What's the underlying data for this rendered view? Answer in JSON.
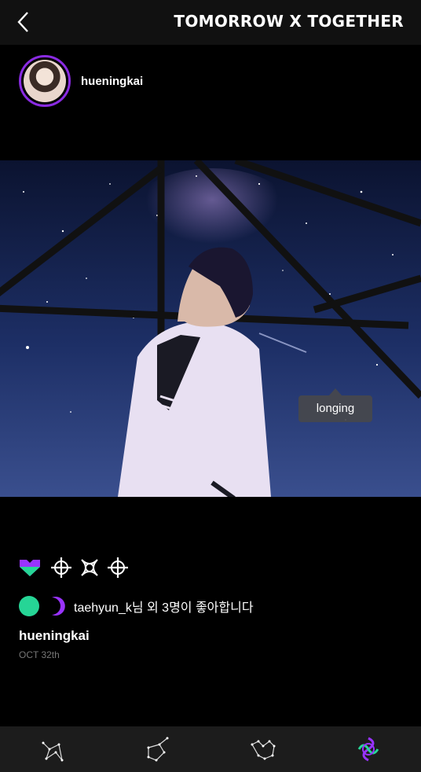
{
  "header": {
    "brand": "TOMORROW X TOGETHER",
    "back_icon": "chevron-left-icon"
  },
  "post": {
    "author": "hueningkai",
    "avatar_ring_color": "#8a2be2",
    "photo_tag": "longing",
    "actions": [
      {
        "name": "like",
        "icon": "heart-icon"
      },
      {
        "name": "reaction-1",
        "icon": "spark-star-icon"
      },
      {
        "name": "reaction-2",
        "icon": "knot-icon"
      },
      {
        "name": "reaction-3",
        "icon": "spark-star-icon"
      }
    ],
    "likes": {
      "avatars": [
        {
          "color": "#26d596"
        },
        {
          "color": "#9933ff"
        }
      ],
      "text": "taehyun_k님 외 3명이 좋아합니다"
    },
    "caption_user": "hueningkai",
    "date": "OCT 32th"
  },
  "bottom_nav": {
    "items": [
      {
        "icon": "constellation-1-icon"
      },
      {
        "icon": "constellation-2-icon"
      },
      {
        "icon": "constellation-3-icon"
      },
      {
        "icon": "txt-logo-icon",
        "active": true
      }
    ]
  },
  "colors": {
    "accent_purple": "#9933ff",
    "accent_green": "#26d596",
    "background": "#000000",
    "nav_background": "#1c1c1c"
  }
}
